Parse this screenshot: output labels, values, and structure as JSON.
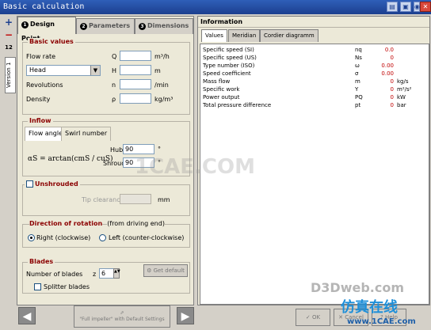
{
  "window": {
    "title": "Basic calculation"
  },
  "left_panel": {
    "tabs": [
      {
        "num": "1",
        "label": "Design Point"
      },
      {
        "num": "2",
        "label": "Parameters"
      },
      {
        "num": "3",
        "label": "Dimensions"
      }
    ],
    "vertical_tab": "Version 1",
    "basic_values": {
      "title": "Basic values",
      "flow_rate": {
        "label": "Flow rate",
        "symbol": "Q",
        "unit": "m³/h",
        "value": ""
      },
      "head": {
        "label": "Head",
        "symbol": "H",
        "unit": "m",
        "value": ""
      },
      "revolutions": {
        "label": "Revolutions",
        "symbol": "n",
        "unit": "/min",
        "value": ""
      },
      "density": {
        "label": "Density",
        "symbol": "ρ",
        "unit": "kg/m³",
        "value": ""
      }
    },
    "inflow": {
      "title": "Inflow",
      "tabs": [
        "Flow angle",
        "Swirl number"
      ],
      "formula": "αS = arctan(cmS / cuS)",
      "hub": {
        "label": "Hub",
        "value": "90",
        "unit": "°"
      },
      "shroud": {
        "label": "Shroud",
        "value": "90",
        "unit": "°"
      }
    },
    "unshrouded": {
      "label": "Unshrouded",
      "tip_clearance": {
        "label": "Tip clearance",
        "unit": "mm",
        "value": ""
      }
    },
    "rotation": {
      "title": "Direction of rotation",
      "note": "(from driving end)",
      "right": "Right (clockwise)",
      "left": "Left (counter-clockwise)"
    },
    "blades": {
      "title": "Blades",
      "count_label": "Number of blades",
      "symbol": "z",
      "count": "6",
      "get_default": "Get default",
      "splitter": "Splitter blades"
    },
    "nav": {
      "center": "\"Full impeller\" with Default Settings"
    }
  },
  "information": {
    "title": "Information",
    "tabs": [
      "Values",
      "Meridian",
      "Cordier diagramm"
    ],
    "rows": [
      {
        "name": "Specific speed (SI)",
        "symbol": "nq",
        "value": "0.0",
        "unit": ""
      },
      {
        "name": "Specific speed (US)",
        "symbol": "Ns",
        "value": "0",
        "unit": ""
      },
      {
        "name": "Type number (ISO)",
        "symbol": "ω",
        "value": "0.00",
        "unit": ""
      },
      {
        "name": "Speed coefficient",
        "symbol": "σ",
        "value": "0.00",
        "unit": ""
      },
      {
        "name": "Mass flow",
        "symbol": "m",
        "value": "0",
        "unit": "kg/s"
      },
      {
        "name": "Specific work",
        "symbol": "Y",
        "value": "0",
        "unit": "m²/s²"
      },
      {
        "name": "Power output",
        "symbol": "PQ",
        "value": "0",
        "unit": "kW"
      },
      {
        "name": "Total pressure difference",
        "symbol": "pt",
        "value": "0",
        "unit": "bar"
      }
    ]
  },
  "buttons": {
    "ok": "OK",
    "cancel": "Cancel",
    "help": "Help"
  },
  "watermarks": [
    "1CAE.COM",
    "D3Dweb.com",
    "仿真在线",
    "www.1CAE.com"
  ]
}
